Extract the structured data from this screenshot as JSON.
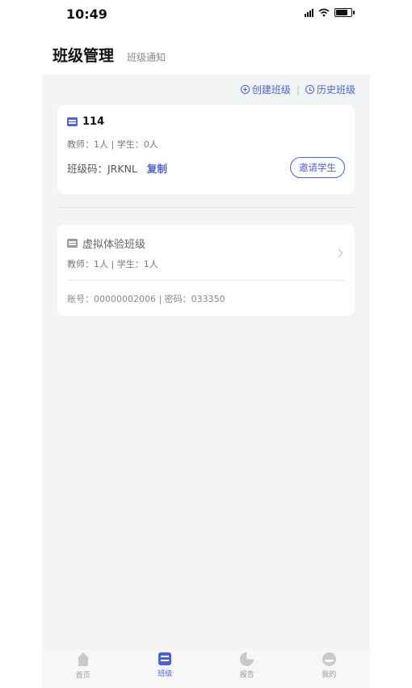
{
  "status_bar": {
    "time": "10:49"
  },
  "header": {
    "title": "班级管理",
    "notice_tab": "班级通知"
  },
  "actions": {
    "create": "创建班级",
    "history": "历史班级"
  },
  "classes": [
    {
      "name": "114",
      "counts": "教师：1人 | 学生：0人",
      "code_label": "班级码：JRKNL",
      "copy_label": "复制",
      "invite_label": "邀请学生"
    },
    {
      "name": "虚拟体验班级",
      "counts": "教师：1人 | 学生：1人",
      "account": "账号：00000002006 | 密码：033350"
    }
  ],
  "tabbar": {
    "tabs": [
      {
        "label": "首页",
        "icon": "home-icon"
      },
      {
        "label": "班级",
        "icon": "class-icon",
        "active": true
      },
      {
        "label": "报告",
        "icon": "pie-chart-icon"
      },
      {
        "label": "我的",
        "icon": "profile-icon"
      }
    ]
  },
  "colors": {
    "accent": "#4a63d8",
    "background": "#f3f4f6"
  }
}
